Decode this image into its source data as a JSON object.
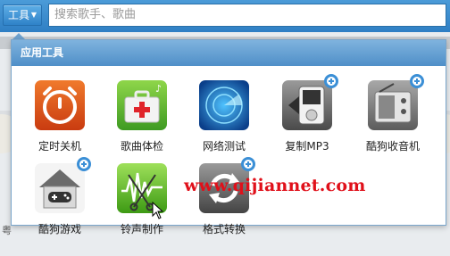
{
  "topbar": {
    "tools_label": "工具",
    "search_placeholder": "搜索歌手、歌曲"
  },
  "panel": {
    "title": "应用工具",
    "tools": [
      {
        "label": "定时关机",
        "icon": "alarm-clock-icon",
        "color": "#e0561e",
        "has_add": false
      },
      {
        "label": "歌曲体检",
        "icon": "medical-kit-icon",
        "color": "#5cb83a",
        "has_add": false
      },
      {
        "label": "网络测试",
        "icon": "radar-icon",
        "color": "#1f6fc4",
        "has_add": false
      },
      {
        "label": "复制MP3",
        "icon": "mp3-copy-icon",
        "color": "#6f6f6f",
        "has_add": true
      },
      {
        "label": "酷狗收音机",
        "icon": "radio-icon",
        "color": "#8a8a8a",
        "has_add": true
      },
      {
        "label": "酷狗游戏",
        "icon": "game-house-icon",
        "color": "#dcdcdc",
        "has_add": true
      },
      {
        "label": "铃声制作",
        "icon": "ringtone-scissors-icon",
        "color": "#6bbf2a",
        "has_add": false
      },
      {
        "label": "格式转换",
        "icon": "convert-arrows-icon",
        "color": "#6c6c6c",
        "has_add": true
      }
    ]
  },
  "background": {
    "left_edge_text": "粤"
  },
  "watermark": "www.qijiannet.com",
  "colors": {
    "topbar": "#3a8cd0",
    "panel_header": "#5c98cc",
    "add_badge": "#3b8fd6",
    "watermark": "#e0101a"
  }
}
